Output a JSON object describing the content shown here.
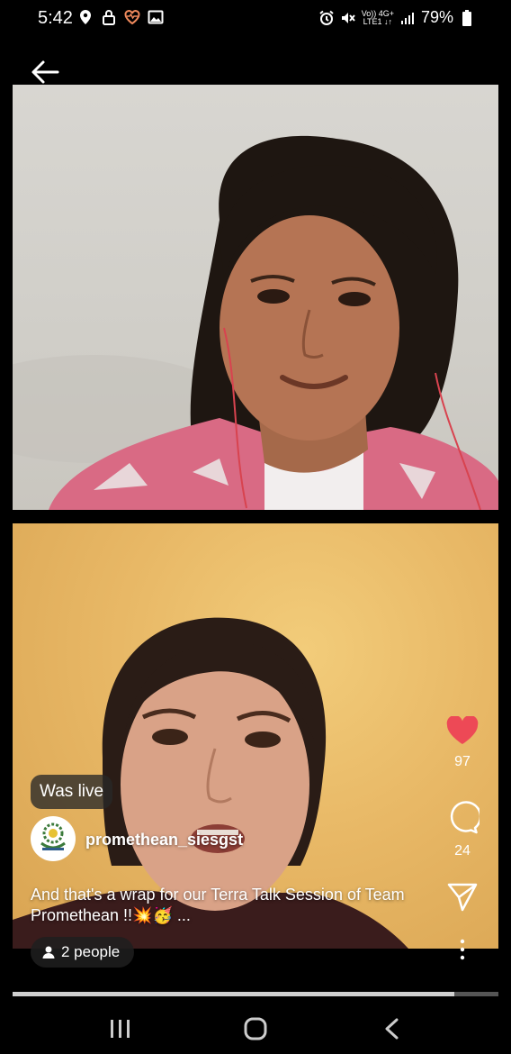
{
  "status_bar": {
    "time": "5:42",
    "network_top": "Vo)) 4G+",
    "network_bottom": "LTE1 ↓↑",
    "battery": "79%",
    "left_icons": [
      "location-icon",
      "lock-icon",
      "heart-monitor-icon",
      "image-icon"
    ],
    "right_icons": [
      "alarm-icon",
      "mute-icon",
      "signal-icon",
      "battery-icon"
    ]
  },
  "live": {
    "badge": "Was live",
    "username": "promethean_siesgst",
    "avatar_icon": "promethean-logo-icon",
    "caption": "And that's a wrap for our Terra Talk Session of Team Promethean !!💥🥳 ...",
    "viewers_label": "2 people"
  },
  "actions": {
    "likes": "97",
    "comments": "24",
    "like_color": "#ed4956"
  },
  "playback": {
    "progress": 0.91
  },
  "colors": {
    "background": "#000000",
    "accent": "#ed4956"
  }
}
